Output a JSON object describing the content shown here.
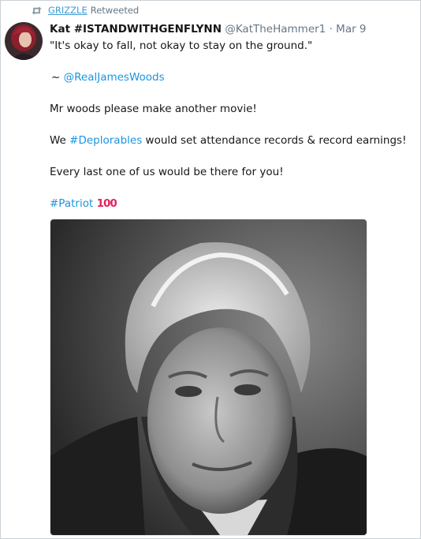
{
  "retweet": {
    "icon": "retweet-icon",
    "user": "GRIZZLE",
    "label": "Retweeted"
  },
  "tweet": {
    "author_name": "Kat #ISTANDWITHGENFLYNN",
    "author_handle": "@KatTheHammer1",
    "separator": "·",
    "date": "Mar 9",
    "lines": {
      "quote": "\"It's okay to fall, not okay to stay on the ground.\"",
      "attribution_prefix": "~ ",
      "attribution_mention": "@RealJamesWoods",
      "movie": "Mr woods please make another movie!",
      "we": "We ",
      "hashtag_deplorables": "#Deplorables",
      "records": " would set attendance records & record earnings!",
      "every": "Every last one of us would be there for you!",
      "hashtag_patriot": "#Patriot",
      "emoji_100": "100"
    },
    "colors": {
      "link": "#1b95e0",
      "muted": "#657786",
      "text": "#14171a"
    }
  }
}
